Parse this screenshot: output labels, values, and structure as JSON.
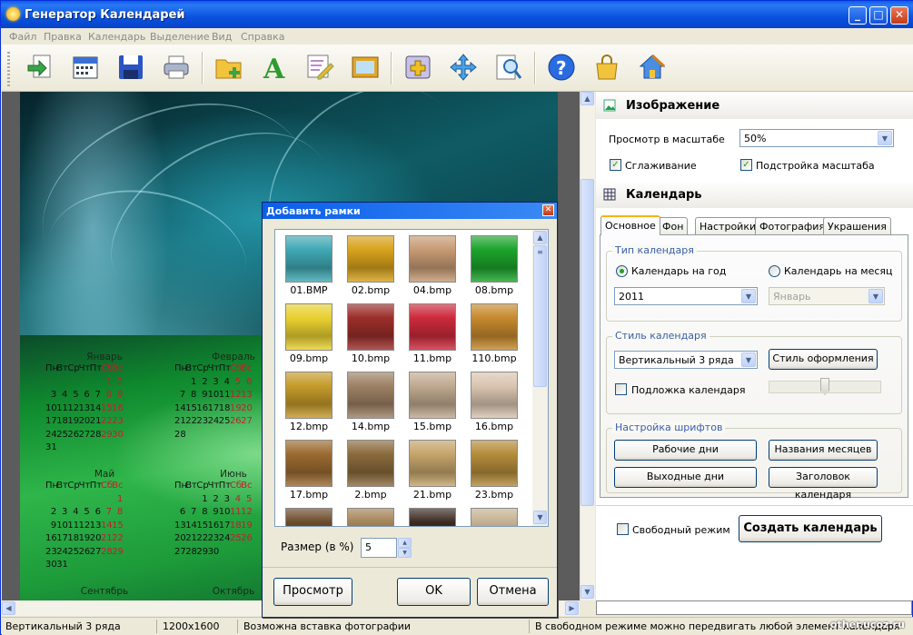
{
  "app": {
    "title": "Генератор Календарей"
  },
  "menu": [
    "Файл",
    "Правка",
    "Календарь",
    "Выделение",
    "Вид",
    "Справка"
  ],
  "calendar_months": [
    {
      "name": "Январь",
      "days_header": [
        "Пн",
        "Вт",
        "Ср",
        "Чт",
        "Пт",
        "Сб",
        "Вс"
      ],
      "rows": [
        [
          "",
          "",
          "",
          "",
          "",
          "1",
          "2"
        ],
        [
          "3",
          "4",
          "5",
          "6",
          "7",
          "8",
          "9"
        ],
        [
          "10",
          "11",
          "12",
          "13",
          "14",
          "15",
          "16"
        ],
        [
          "17",
          "18",
          "19",
          "20",
          "21",
          "22",
          "23"
        ],
        [
          "24",
          "25",
          "26",
          "27",
          "28",
          "29",
          "30"
        ],
        [
          "31",
          "",
          "",
          "",
          "",
          "",
          ""
        ]
      ]
    },
    {
      "name": "Февраль",
      "days_header": [
        "Пн",
        "Вт",
        "Ср",
        "Чт",
        "Пт",
        "Сб",
        "Вс"
      ],
      "rows": [
        [
          "",
          "1",
          "2",
          "3",
          "4",
          "5",
          "6"
        ],
        [
          "7",
          "8",
          "9",
          "10",
          "11",
          "12",
          "13"
        ],
        [
          "14",
          "15",
          "16",
          "17",
          "18",
          "19",
          "20"
        ],
        [
          "21",
          "22",
          "23",
          "24",
          "25",
          "26",
          "27"
        ],
        [
          "28",
          "",
          "",
          "",
          "",
          "",
          ""
        ]
      ]
    },
    {
      "name": "Май",
      "days_header": [
        "Пн",
        "Вт",
        "Ср",
        "Чт",
        "Пт",
        "Сб",
        "Вс"
      ],
      "rows": [
        [
          "",
          "",
          "",
          "",
          "",
          "",
          "1"
        ],
        [
          "2",
          "3",
          "4",
          "5",
          "6",
          "7",
          "8"
        ],
        [
          "9",
          "10",
          "11",
          "12",
          "13",
          "14",
          "15"
        ],
        [
          "16",
          "17",
          "18",
          "19",
          "20",
          "21",
          "22"
        ],
        [
          "23",
          "24",
          "25",
          "26",
          "27",
          "28",
          "29"
        ],
        [
          "30",
          "31",
          "",
          "",
          "",
          "",
          ""
        ]
      ]
    },
    {
      "name": "Июнь",
      "days_header": [
        "Пн",
        "Вт",
        "Ср",
        "Чт",
        "Пт",
        "Сб",
        "Вс"
      ],
      "rows": [
        [
          "",
          "",
          "1",
          "2",
          "3",
          "4",
          "5"
        ],
        [
          "6",
          "7",
          "8",
          "9",
          "10",
          "11",
          "12"
        ],
        [
          "13",
          "14",
          "15",
          "16",
          "17",
          "18",
          "19"
        ],
        [
          "20",
          "21",
          "22",
          "23",
          "24",
          "25",
          "26"
        ],
        [
          "27",
          "28",
          "29",
          "30",
          "",
          "",
          ""
        ]
      ]
    }
  ],
  "calendar_months_next": [
    "Сентябрь",
    "Октябрь"
  ],
  "image_section": {
    "title": "Изображение",
    "zoom_label": "Просмотр в масштабе",
    "zoom_value": "50%",
    "smoothing": "Сглаживание",
    "fit_scale": "Подстройка масштаба"
  },
  "calendar_section": {
    "title": "Календарь"
  },
  "tabs": [
    "Основное",
    "Фон",
    "Настройки",
    "Фотография",
    "Украшения"
  ],
  "calendar_type": {
    "group": "Тип календаря",
    "year": "Календарь на год",
    "month": "Календарь на месяц",
    "year_value": "2011",
    "month_value": "Январь"
  },
  "calendar_style": {
    "group": "Стиль календаря",
    "style_value": "Вертикальный 3 ряда",
    "style_button": "Стиль оформления",
    "underlay": "Подложка календаря"
  },
  "fonts": {
    "group": "Настройка шрифтов",
    "workdays": "Рабочие дни",
    "month_names": "Названия месяцев",
    "weekends": "Выходные дни",
    "calendar_title": "Заголовок календаря"
  },
  "bottom": {
    "free_mode": "Свободный режим",
    "create": "Создать календарь"
  },
  "status": {
    "style": "Вертикальный 3 ряда",
    "size": "1200x1600",
    "insert": "Возможна вставка фотографии",
    "hint": "В свободном режиме можно передвигать любой элемент календаря",
    "watermark": "other.ucoz.ru"
  },
  "dialog": {
    "title": "Добавить рамки",
    "size_label": "Размер (в %)",
    "size_value": "5",
    "preview": "Просмотр",
    "ok": "OK",
    "cancel": "Отмена",
    "frames": [
      {
        "name": "01.BMP",
        "color": "#3fa8b4"
      },
      {
        "name": "02.bmp",
        "color": "#d7a21c"
      },
      {
        "name": "04.bmp",
        "color": "#c59a73"
      },
      {
        "name": "08.bmp",
        "color": "#1ca32b"
      },
      {
        "name": "09.bmp",
        "color": "#e9d030"
      },
      {
        "name": "10.bmp",
        "color": "#9a2e2a"
      },
      {
        "name": "11.bmp",
        "color": "#cc2a3b"
      },
      {
        "name": "110.bmp",
        "color": "#c6892d"
      },
      {
        "name": "12.bmp",
        "color": "#c59a2a"
      },
      {
        "name": "14.bmp",
        "color": "#9c8064"
      },
      {
        "name": "15.bmp",
        "color": "#bfa98f"
      },
      {
        "name": "16.bmp",
        "color": "#d9c4b0"
      },
      {
        "name": "17.bmp",
        "color": "#9b6a30"
      },
      {
        "name": "2.bmp",
        "color": "#8a6a3c"
      },
      {
        "name": "21.bmp",
        "color": "#c4a46a"
      },
      {
        "name": "23.bmp",
        "color": "#b48c3a"
      },
      {
        "name": "",
        "color": "#6a4a2a"
      },
      {
        "name": "",
        "color": "#a38256"
      },
      {
        "name": "",
        "color": "#3a2a20"
      },
      {
        "name": "",
        "color": "#c4b090"
      }
    ]
  }
}
